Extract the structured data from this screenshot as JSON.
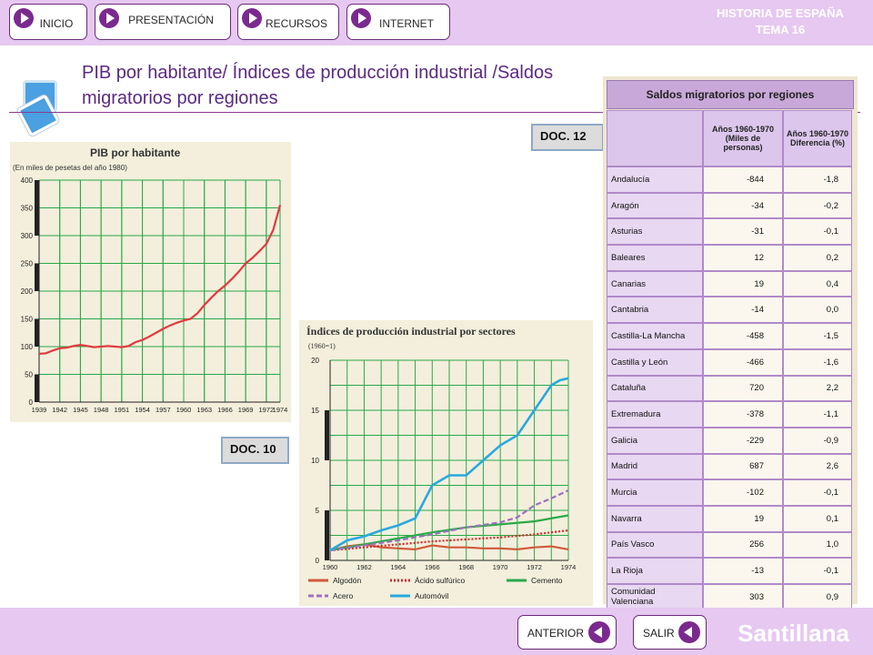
{
  "nav": {
    "inicio": "INICIO",
    "presentacion": "PRESENTACIÓN",
    "recursos": "RECURSOS",
    "internet": "INTERNET"
  },
  "course": {
    "line1": "HISTORIA DE ESPAÑA",
    "line2": "TEMA 16"
  },
  "page_title": "PIB por habitante/ Índices de producción industrial /Saldos migratorios por regiones",
  "doc_labels": {
    "doc10": "DOC. 10",
    "doc12": "DOC. 12"
  },
  "footer": {
    "anterior": "ANTERIOR",
    "salir": "SALIR",
    "brand": "Santillana"
  },
  "chart_data": [
    {
      "type": "line",
      "title": "PIB por habitante",
      "subtitle": "(En miles de pesetas del año 1980)",
      "x_ticks": [
        "1939",
        "1942",
        "1945",
        "1948",
        "1951",
        "1954",
        "1957",
        "1960",
        "1963",
        "1966",
        "1969",
        "1972",
        "1974"
      ],
      "ylim": [
        0,
        400
      ],
      "y_ticks": [
        0,
        50,
        100,
        150,
        200,
        250,
        300,
        350,
        400
      ],
      "grid": true,
      "color": "#e03a40",
      "series": [
        {
          "x": [
            1939,
            1940,
            1941,
            1942,
            1943,
            1944,
            1945,
            1946,
            1947,
            1948,
            1949,
            1950,
            1951,
            1952,
            1953,
            1954,
            1955,
            1956,
            1957,
            1958,
            1959,
            1960,
            1961,
            1962,
            1963,
            1964,
            1965,
            1966,
            1967,
            1968,
            1969,
            1970,
            1971,
            1972,
            1973,
            1974
          ],
          "values": [
            87,
            88,
            93,
            97,
            98,
            101,
            103,
            101,
            99,
            100,
            101,
            100,
            99,
            101,
            108,
            112,
            118,
            125,
            132,
            138,
            143,
            147,
            150,
            160,
            175,
            188,
            200,
            210,
            222,
            235,
            250,
            260,
            272,
            285,
            310,
            355
          ]
        }
      ]
    },
    {
      "type": "line",
      "title": "Índices de producción industrial por sectores",
      "subtitle": "(1960=1)",
      "x_ticks": [
        "1960",
        "1962",
        "1964",
        "1966",
        "1968",
        "1970",
        "1972",
        "1974"
      ],
      "ylim": [
        0,
        20
      ],
      "y_ticks": [
        0,
        5,
        10,
        15,
        20
      ],
      "grid": true,
      "legend_position": "bottom",
      "series": [
        {
          "name": "Algodón",
          "color": "#d05a3a",
          "style": "solid",
          "x": [
            1960,
            1961,
            1962,
            1963,
            1964,
            1965,
            1966,
            1967,
            1968,
            1969,
            1970,
            1971,
            1972,
            1973,
            1974
          ],
          "values": [
            1.0,
            1.4,
            1.6,
            1.3,
            1.2,
            1.1,
            1.5,
            1.3,
            1.3,
            1.2,
            1.2,
            1.1,
            1.3,
            1.4,
            1.1
          ]
        },
        {
          "name": "Ácido sulfúrico",
          "color": "#d02a2a",
          "style": "dotted",
          "x": [
            1960,
            1962,
            1964,
            1966,
            1968,
            1970,
            1972,
            1974
          ],
          "values": [
            1.0,
            1.3,
            1.6,
            1.9,
            2.1,
            2.3,
            2.6,
            3.0
          ]
        },
        {
          "name": "Cemento",
          "color": "#2aaa4a",
          "style": "solid",
          "x": [
            1960,
            1962,
            1964,
            1966,
            1968,
            1970,
            1972,
            1974
          ],
          "values": [
            1.0,
            1.6,
            2.2,
            2.8,
            3.3,
            3.6,
            3.9,
            4.5
          ]
        },
        {
          "name": "Acero",
          "color": "#a070c0",
          "style": "dashed",
          "x": [
            1960,
            1962,
            1964,
            1966,
            1968,
            1970,
            1971,
            1972,
            1973,
            1974
          ],
          "values": [
            1.0,
            1.5,
            2.0,
            2.6,
            3.3,
            3.8,
            4.3,
            5.5,
            6.2,
            7.0
          ]
        },
        {
          "name": "Automóvil",
          "color": "#2aa8e0",
          "style": "solid",
          "x": [
            1960,
            1961,
            1962,
            1963,
            1964,
            1965,
            1966,
            1966.5,
            1967,
            1968,
            1969,
            1970,
            1971,
            1972,
            1973,
            1973.5,
            1974
          ],
          "values": [
            1.0,
            2.0,
            2.4,
            3.0,
            3.5,
            4.2,
            7.5,
            8.0,
            8.5,
            8.5,
            10.0,
            11.5,
            12.5,
            15.0,
            17.5,
            18.0,
            18.2
          ]
        }
      ]
    }
  ],
  "migration": {
    "title": "Saldos migratorios por regiones",
    "col1": "Años 1960-1970 (Miles de personas)",
    "col2": "Años 1960-1970 Diferencia (%)",
    "rows": [
      {
        "region": "Andalucía",
        "miles": "-844",
        "pct": "-1,8"
      },
      {
        "region": "Aragón",
        "miles": "-34",
        "pct": "-0,2"
      },
      {
        "region": "Asturias",
        "miles": "-31",
        "pct": "-0,1"
      },
      {
        "region": "Baleares",
        "miles": "12",
        "pct": "0,2"
      },
      {
        "region": "Canarias",
        "miles": "19",
        "pct": "0,4"
      },
      {
        "region": "Cantabria",
        "miles": "-14",
        "pct": "0,0"
      },
      {
        "region": "Castilla-La Mancha",
        "miles": "-458",
        "pct": "-1,5"
      },
      {
        "region": "Castilla y León",
        "miles": "-466",
        "pct": "-1,6"
      },
      {
        "region": "Cataluña",
        "miles": "720",
        "pct": "2,2"
      },
      {
        "region": "Extremadura",
        "miles": "-378",
        "pct": "-1,1"
      },
      {
        "region": "Galicia",
        "miles": "-229",
        "pct": "-0,9"
      },
      {
        "region": "Madrid",
        "miles": "687",
        "pct": "2,6"
      },
      {
        "region": "Murcia",
        "miles": "-102",
        "pct": "-0,1"
      },
      {
        "region": "Navarra",
        "miles": "19",
        "pct": "0,1"
      },
      {
        "region": "País Vasco",
        "miles": "256",
        "pct": "1,0"
      },
      {
        "region": "La Rioja",
        "miles": "-13",
        "pct": "-0,1"
      },
      {
        "region": "Comunidad Valenciana",
        "miles": "303",
        "pct": "0,9"
      }
    ]
  }
}
